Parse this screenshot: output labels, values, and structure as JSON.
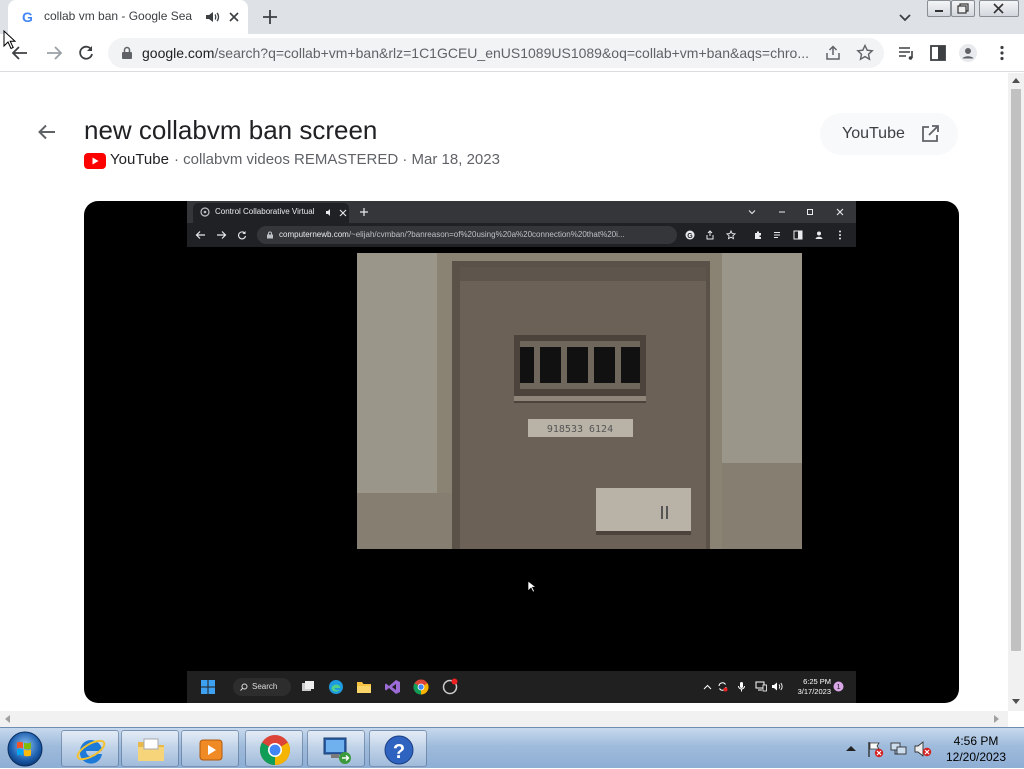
{
  "browser": {
    "tab_title": "collab vm ban - Google Sear",
    "url_host": "google.com",
    "url_rest": "/search?q=collab+vm+ban&rlz=1C1GCEU_enUS1089US1089&oq=collab+vm+ban&aqs=chro..."
  },
  "result": {
    "title": "new collabvm ban screen",
    "source": "YouTube",
    "meta_rest": "· collabvm videos REMASTERED · Mar 18, 2023",
    "open_button": "YouTube"
  },
  "video_frame": {
    "inner_tab_title": "Control Collaborative Virtual",
    "inner_url_host": "computernewb.com",
    "inner_url_rest": "/~elijah/cvmban/?banreason=of%20using%20a%20connection%20that%20i...",
    "cell_number": "918533 6124",
    "inner_search": "Search",
    "inner_time": "6:25 PM",
    "inner_date": "3/17/2023"
  },
  "taskbar": {
    "time": "4:56 PM",
    "date": "12/20/2023"
  },
  "colors": {
    "chrome_tabstrip": "#dee1e6",
    "youtube_red": "#ff0000",
    "win7_taskbar": "#9fbbdc"
  }
}
